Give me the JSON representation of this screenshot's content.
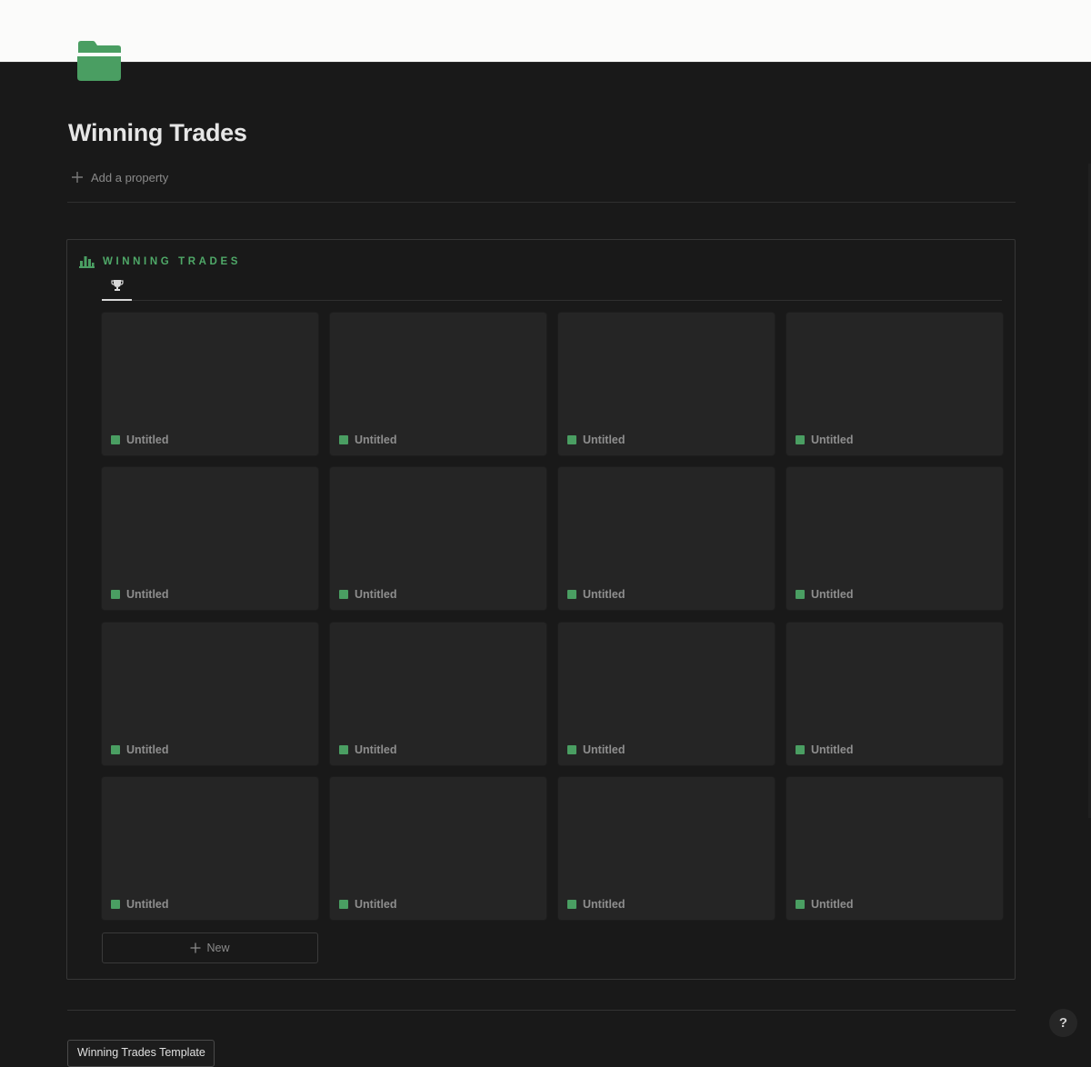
{
  "page": {
    "title": "Winning Trades",
    "icon": "folder-icon",
    "icon_color": "#4a9e62",
    "add_property_label": "Add a property"
  },
  "database": {
    "title": "WINNING TRADES",
    "title_color": "#4fa868",
    "icon": "bar-chart-icon",
    "tabs": [
      {
        "icon": "trophy-icon",
        "active": true
      }
    ],
    "cards": [
      {
        "title": "Untitled"
      },
      {
        "title": "Untitled"
      },
      {
        "title": "Untitled"
      },
      {
        "title": "Untitled"
      },
      {
        "title": "Untitled"
      },
      {
        "title": "Untitled"
      },
      {
        "title": "Untitled"
      },
      {
        "title": "Untitled"
      },
      {
        "title": "Untitled"
      },
      {
        "title": "Untitled"
      },
      {
        "title": "Untitled"
      },
      {
        "title": "Untitled"
      },
      {
        "title": "Untitled"
      },
      {
        "title": "Untitled"
      },
      {
        "title": "Untitled"
      },
      {
        "title": "Untitled"
      }
    ],
    "new_label": "New"
  },
  "template_button_label": "Winning Trades Template",
  "help_label": "?",
  "colors": {
    "background": "#191919",
    "card": "#252525",
    "accent_green": "#4a9e62"
  }
}
